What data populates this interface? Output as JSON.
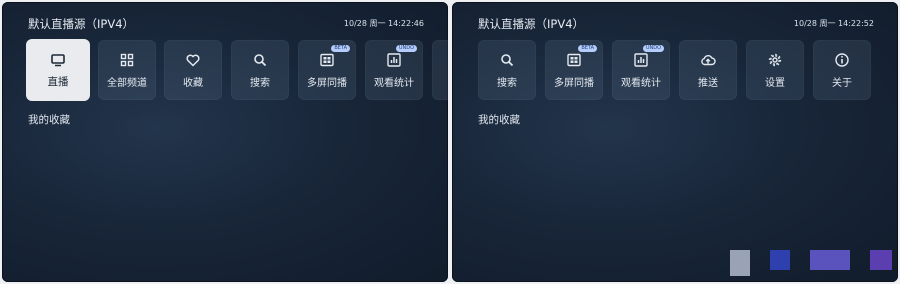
{
  "left": {
    "title": "默认直播源（IPV4）",
    "time": "10/28 周一 14:22:46",
    "tiles": [
      {
        "label": "直播",
        "icon": "tv-icon"
      },
      {
        "label": "全部频道",
        "icon": "grid-icon"
      },
      {
        "label": "收藏",
        "icon": "heart-icon"
      },
      {
        "label": "搜索",
        "icon": "search-icon"
      },
      {
        "label": "多屏同播",
        "icon": "multiscreen-icon",
        "badge": "BETA"
      },
      {
        "label": "观看统计",
        "icon": "stats-icon",
        "badge": "UNDO"
      }
    ],
    "section_label": "我的收藏"
  },
  "right": {
    "title": "默认直播源（IPV4）",
    "time": "10/28 周一 14:22:52",
    "tiles": [
      {
        "label": "搜索",
        "icon": "search-icon"
      },
      {
        "label": "多屏同播",
        "icon": "multiscreen-icon",
        "badge": "BETA"
      },
      {
        "label": "观看统计",
        "icon": "stats-icon",
        "badge": "UNDO"
      },
      {
        "label": "推送",
        "icon": "cloud-upload-icon"
      },
      {
        "label": "设置",
        "icon": "gear-icon"
      },
      {
        "label": "关于",
        "icon": "info-icon"
      }
    ],
    "section_label": "我的收藏"
  },
  "colors": {
    "panel_bg": "#182639",
    "active_tile": "#e9ebee",
    "badge_bg": "#b5cdfa",
    "swatch_gray": "#9aa3b3",
    "swatch_blue": "#2e3fae",
    "swatch_indigo": "#5a53bd",
    "swatch_violet": "#5b3fb0"
  }
}
